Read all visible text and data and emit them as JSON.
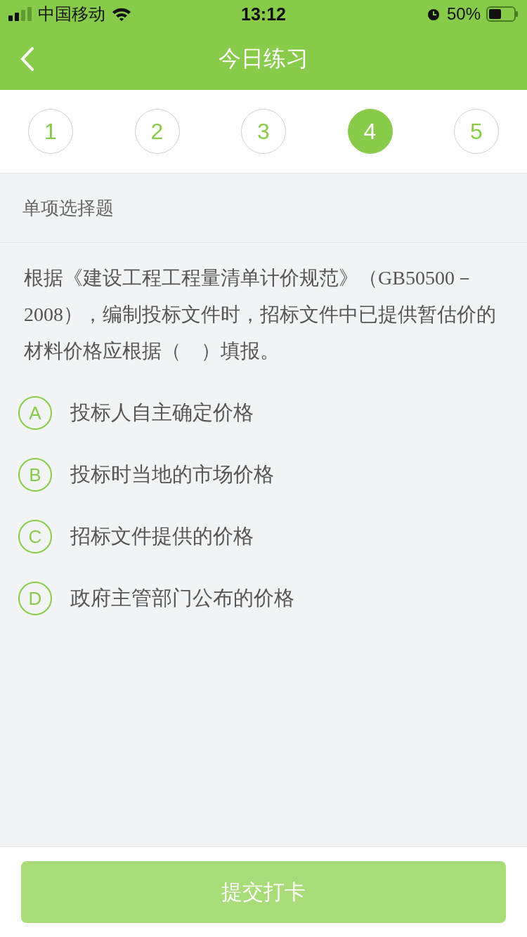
{
  "status_bar": {
    "carrier": "中国移动",
    "time": "13:12",
    "battery": "50%"
  },
  "nav": {
    "title": "今日练习"
  },
  "steps": [
    {
      "label": "1",
      "selected": false
    },
    {
      "label": "2",
      "selected": false
    },
    {
      "label": "3",
      "selected": false
    },
    {
      "label": "4",
      "selected": true
    },
    {
      "label": "5",
      "selected": false
    }
  ],
  "section": "单项选择题",
  "question": "根据《建设工程工程量清单计价规范》（GB50500－2008），编制投标文件时，招标文件中已提供暂估价的材料价格应根据（　）填报。",
  "options": [
    {
      "letter": "A",
      "text": "投标人自主确定价格",
      "selected": false
    },
    {
      "letter": "B",
      "text": "投标时当地的市场价格",
      "selected": false
    },
    {
      "letter": "C",
      "text": "招标文件提供的价格",
      "selected": false
    },
    {
      "letter": "D",
      "text": "政府主管部门公布的价格",
      "selected": false
    }
  ],
  "submit": {
    "label": "提交打卡",
    "disabled": true
  }
}
